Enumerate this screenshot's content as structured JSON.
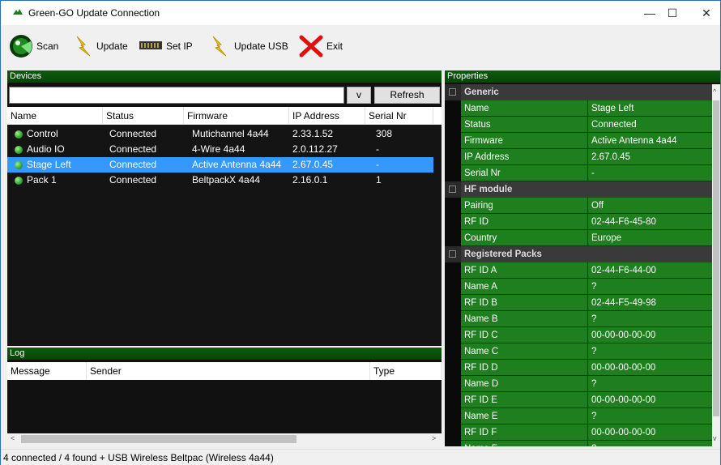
{
  "window": {
    "title": "Green-GO Update Connection",
    "min": "—",
    "max": "☐",
    "close": "✕"
  },
  "toolbar": {
    "scan": "Scan",
    "update": "Update",
    "set_ip": "Set IP",
    "update_usb": "Update USB",
    "exit": "Exit"
  },
  "devices": {
    "title": "Devices",
    "filter_value": "",
    "filter_button": "v",
    "refresh": "Refresh",
    "columns": [
      "Name",
      "Status",
      "Firmware",
      "IP Address",
      "Serial Nr"
    ],
    "rows": [
      {
        "name": "Control",
        "status": "Connected",
        "firmware": "Mutichannel 4a44",
        "ip": "2.33.1.52",
        "serial": "308"
      },
      {
        "name": "Audio IO",
        "status": "Connected",
        "firmware": "4-Wire 4a44",
        "ip": "2.0.112.27",
        "serial": "-"
      },
      {
        "name": "Stage Left",
        "status": "Connected",
        "firmware": "Active Antenna 4a44",
        "ip": "2.67.0.45",
        "serial": "-"
      },
      {
        "name": "Pack 1",
        "status": "Connected",
        "firmware": "BeltpackX 4a44",
        "ip": "2.16.0.1",
        "serial": "1"
      }
    ],
    "selected_index": 2
  },
  "log": {
    "title": "Log",
    "columns": [
      "Message",
      "Sender",
      "Type"
    ]
  },
  "properties": {
    "title": "Properties",
    "rows": [
      {
        "cat": "Generic"
      },
      {
        "k": "Name",
        "v": "Stage Left"
      },
      {
        "k": "Status",
        "v": "Connected"
      },
      {
        "k": "Firmware",
        "v": "Active Antenna 4a44"
      },
      {
        "k": "IP Address",
        "v": "2.67.0.45"
      },
      {
        "k": "Serial Nr",
        "v": "-"
      },
      {
        "cat": "HF module"
      },
      {
        "k": "Pairing",
        "v": "Off"
      },
      {
        "k": "RF ID",
        "v": "02-44-F6-45-80"
      },
      {
        "k": "Country",
        "v": "Europe"
      },
      {
        "cat": "Registered Packs"
      },
      {
        "k": "RF ID A",
        "v": "02-44-F6-44-00"
      },
      {
        "k": "Name A",
        "v": "?"
      },
      {
        "k": "RF ID B",
        "v": "02-44-F5-49-98"
      },
      {
        "k": "Name B",
        "v": "?"
      },
      {
        "k": "RF ID C",
        "v": "00-00-00-00-00"
      },
      {
        "k": "Name C",
        "v": "?"
      },
      {
        "k": "RF ID D",
        "v": "00-00-00-00-00"
      },
      {
        "k": "Name D",
        "v": "?"
      },
      {
        "k": "RF ID E",
        "v": "00-00-00-00-00"
      },
      {
        "k": "Name E",
        "v": "?"
      },
      {
        "k": "RF ID F",
        "v": "00-00-00-00-00"
      },
      {
        "k": "Name F",
        "v": "?"
      }
    ]
  },
  "status": {
    "text": "4 connected / 4 found + USB Wireless Beltpac (Wireless 4a44)"
  },
  "colors": {
    "accent": "#1d7f1d",
    "selection": "#3399ff",
    "header": "#0e5a0e"
  }
}
